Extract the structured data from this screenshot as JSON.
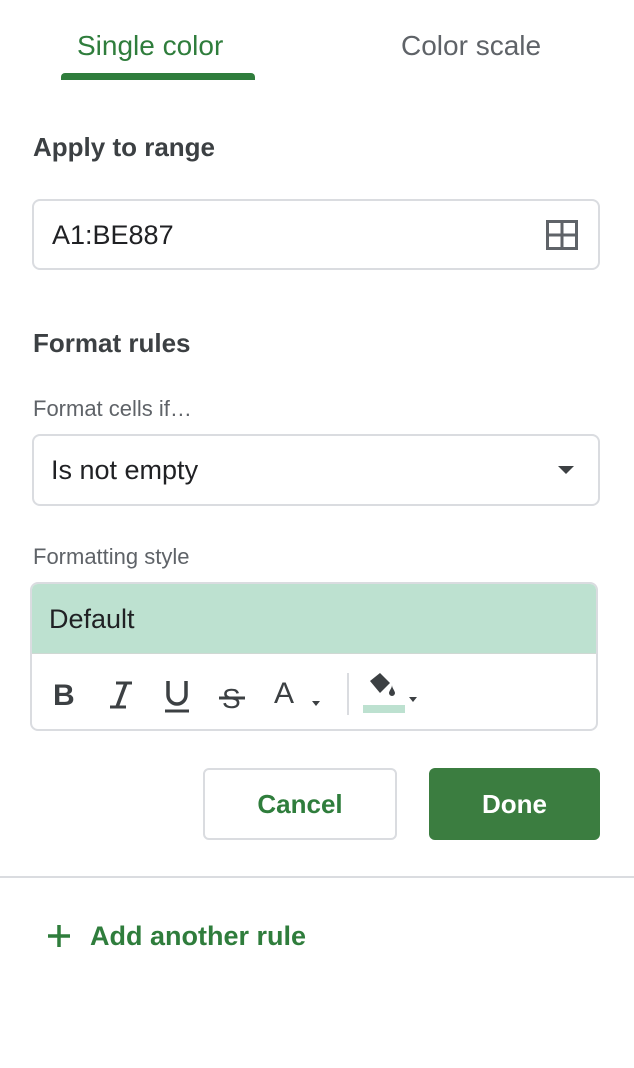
{
  "tabs": [
    {
      "label": "Single color",
      "active": true
    },
    {
      "label": "Color scale",
      "active": false
    }
  ],
  "apply_range": {
    "heading": "Apply to range",
    "value": "A1:BE887",
    "icon": "select-range-grid-icon"
  },
  "format_rules": {
    "heading": "Format rules",
    "condition_label": "Format cells if…",
    "condition_value": "Is not empty",
    "style_label": "Formatting style",
    "style_preview": "Default",
    "style_fill_color": "#bde1d0",
    "toolbar": [
      "bold-icon",
      "italic-icon",
      "underline-icon",
      "strikethrough-icon",
      "text-color-icon",
      "fill-color-icon"
    ]
  },
  "buttons": {
    "cancel": "Cancel",
    "done": "Done"
  },
  "add_rule": {
    "label": "Add another rule"
  },
  "colors": {
    "accent": "#2f7d3c",
    "done_bg": "#3b7d40",
    "border": "#dadce0"
  }
}
